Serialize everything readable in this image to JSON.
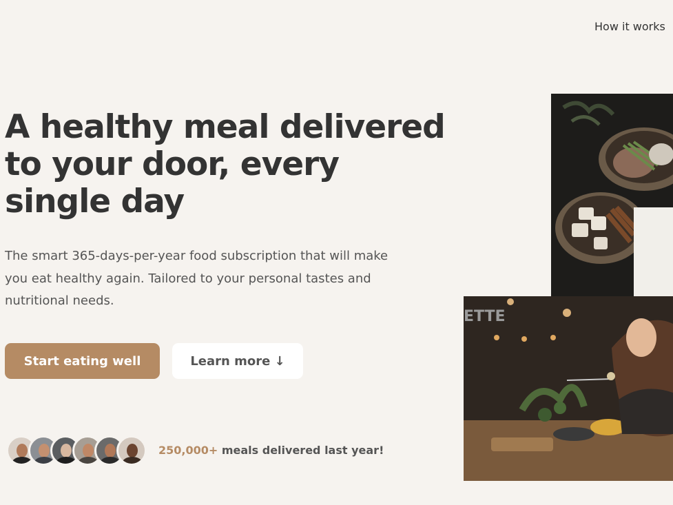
{
  "nav": {
    "how_it_works": "How it works"
  },
  "hero": {
    "title": "A healthy meal delivered to your door, every single day",
    "description": "The smart 365-days-per-year food subscription that will make you eat healthy again. Tailored to your personal tastes and nutritional needs.",
    "primary_button": "Start eating well",
    "secondary_button": "Learn more ↓"
  },
  "customers": {
    "count": "250,000+",
    "text": " meals delivered last year!",
    "avatars": [
      "customer-1",
      "customer-2",
      "customer-3",
      "customer-4",
      "customer-5",
      "customer-6"
    ]
  },
  "images": {
    "food": "food-bowls-photo",
    "restaurant": "woman-eating-at-restaurant-photo"
  },
  "colors": {
    "background": "#f6f3ef",
    "accent": "#b58b64",
    "text": "#333333"
  }
}
